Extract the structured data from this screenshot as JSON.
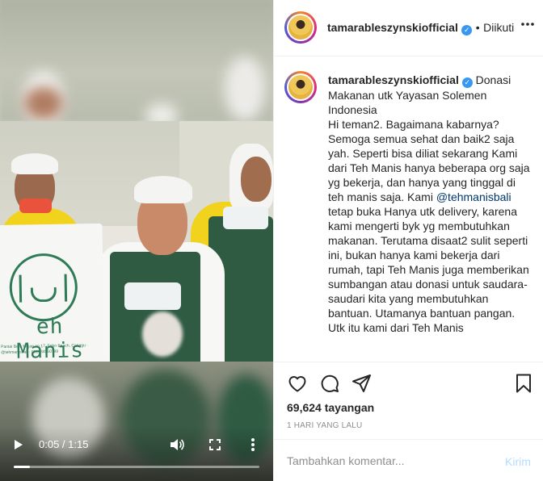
{
  "video": {
    "bag_brand": "eh Manis",
    "bag_address": "Pantai Batu Mejan no 17, Echo Beach, Canggu · @tehmanisbali · 081234560789",
    "time_display": "0:05 / 1:15",
    "progress_fraction": 0.067,
    "icons": [
      "play-icon",
      "volume-icon",
      "fullscreen-icon",
      "more-vertical-icon"
    ]
  },
  "header": {
    "username": "tamarableszynskiofficial",
    "verified_mark": "✓",
    "separator": "•",
    "follow_label": "Diikuti"
  },
  "caption": {
    "username": "tamarableszynskiofficial",
    "title": "Donasi Makanan utk Yayasan Solemen Indonesia",
    "body_before_mention": "Hi teman2. Bagaimana kabarnya? Semoga semua sehat dan baik2 saja yah. Seperti bisa diliat sekarang Kami dari Teh Manis hanya beberapa org saja yg bekerja, dan hanya yang tinggal di teh manis saja. Kami",
    "mention": "@tehmanisbali",
    "body_after_mention": "tetap buka Hanya utk delivery, karena kami mengerti byk yg membutuhkan makanan. Terutama disaat2 sulit seperti ini, bukan hanya kami bekerja dari rumah, tapi Teh Manis juga memberikan sumbangan atau donasi untuk saudara-saudari kita yang membutuhkan bantuan. Utamanya bantuan pangan.",
    "body_cutoff": "Utk itu kami dari Teh Manis"
  },
  "actions": {
    "icons": [
      "heart-icon",
      "comment-icon",
      "share-icon",
      "bookmark-icon"
    ],
    "views": "69,624 tayangan",
    "time_ago": "1 HARI YANG LALU"
  },
  "comment": {
    "placeholder": "Tambahkan komentar...",
    "post_label": "Kirim"
  },
  "colors": {
    "verified": "#3897f0",
    "mention": "#00376b",
    "post_disabled": "#b3dbff",
    "apron": "#2f5b43",
    "brand_green": "#2e7b56"
  }
}
